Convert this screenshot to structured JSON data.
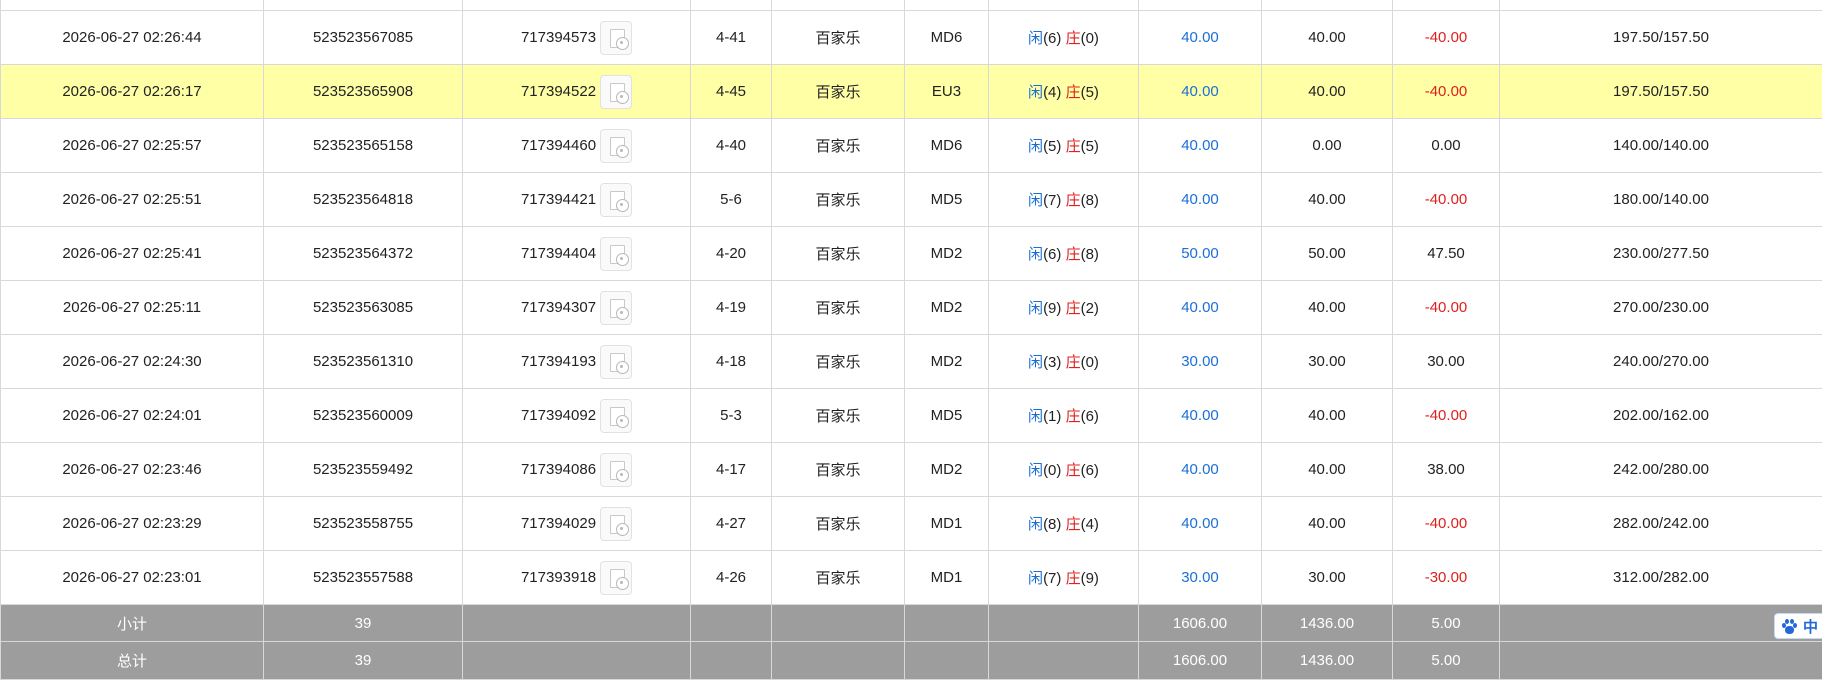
{
  "colors": {
    "blue": "#1a6fd6",
    "red": "#e0201f",
    "highlight": "#ffffa6",
    "summary_bg": "#9d9d9d"
  },
  "records": [
    {
      "time": "2026-06-27 02:26:44",
      "bet_id": "523523567085",
      "game_id": "717394573",
      "shoe": "4-41",
      "game_type": "百家乐",
      "table": "MD6",
      "player_label": "闲",
      "player_score": "(6)",
      "banker_label": "庄",
      "banker_score": "(0)",
      "bet_amount": "40.00",
      "valid_bet": "40.00",
      "win_loss": "-40.00",
      "balance": "197.50/157.50"
    },
    {
      "time": "2026-06-27 02:26:17",
      "bet_id": "523523565908",
      "game_id": "717394522",
      "shoe": "4-45",
      "game_type": "百家乐",
      "table": "EU3",
      "player_label": "闲",
      "player_score": "(4)",
      "banker_label": "庄",
      "banker_score": "(5)",
      "bet_amount": "40.00",
      "valid_bet": "40.00",
      "win_loss": "-40.00",
      "balance": "197.50/157.50"
    },
    {
      "time": "2026-06-27 02:25:57",
      "bet_id": "523523565158",
      "game_id": "717394460",
      "shoe": "4-40",
      "game_type": "百家乐",
      "table": "MD6",
      "player_label": "闲",
      "player_score": "(5)",
      "banker_label": "庄",
      "banker_score": "(5)",
      "bet_amount": "40.00",
      "valid_bet": "0.00",
      "win_loss": "0.00",
      "balance": "140.00/140.00"
    },
    {
      "time": "2026-06-27 02:25:51",
      "bet_id": "523523564818",
      "game_id": "717394421",
      "shoe": "5-6",
      "game_type": "百家乐",
      "table": "MD5",
      "player_label": "闲",
      "player_score": "(7)",
      "banker_label": "庄",
      "banker_score": "(8)",
      "bet_amount": "40.00",
      "valid_bet": "40.00",
      "win_loss": "-40.00",
      "balance": "180.00/140.00"
    },
    {
      "time": "2026-06-27 02:25:41",
      "bet_id": "523523564372",
      "game_id": "717394404",
      "shoe": "4-20",
      "game_type": "百家乐",
      "table": "MD2",
      "player_label": "闲",
      "player_score": "(6)",
      "banker_label": "庄",
      "banker_score": "(8)",
      "bet_amount": "50.00",
      "valid_bet": "50.00",
      "win_loss": "47.50",
      "balance": "230.00/277.50"
    },
    {
      "time": "2026-06-27 02:25:11",
      "bet_id": "523523563085",
      "game_id": "717394307",
      "shoe": "4-19",
      "game_type": "百家乐",
      "table": "MD2",
      "player_label": "闲",
      "player_score": "(9)",
      "banker_label": "庄",
      "banker_score": "(2)",
      "bet_amount": "40.00",
      "valid_bet": "40.00",
      "win_loss": "-40.00",
      "balance": "270.00/230.00"
    },
    {
      "time": "2026-06-27 02:24:30",
      "bet_id": "523523561310",
      "game_id": "717394193",
      "shoe": "4-18",
      "game_type": "百家乐",
      "table": "MD2",
      "player_label": "闲",
      "player_score": "(3)",
      "banker_label": "庄",
      "banker_score": "(0)",
      "bet_amount": "30.00",
      "valid_bet": "30.00",
      "win_loss": "30.00",
      "balance": "240.00/270.00"
    },
    {
      "time": "2026-06-27 02:24:01",
      "bet_id": "523523560009",
      "game_id": "717394092",
      "shoe": "5-3",
      "game_type": "百家乐",
      "table": "MD5",
      "player_label": "闲",
      "player_score": "(1)",
      "banker_label": "庄",
      "banker_score": "(6)",
      "bet_amount": "40.00",
      "valid_bet": "40.00",
      "win_loss": "-40.00",
      "balance": "202.00/162.00"
    },
    {
      "time": "2026-06-27 02:23:46",
      "bet_id": "523523559492",
      "game_id": "717394086",
      "shoe": "4-17",
      "game_type": "百家乐",
      "table": "MD2",
      "player_label": "闲",
      "player_score": "(0)",
      "banker_label": "庄",
      "banker_score": "(6)",
      "bet_amount": "40.00",
      "valid_bet": "40.00",
      "win_loss": "38.00",
      "balance": "242.00/280.00"
    },
    {
      "time": "2026-06-27 02:23:29",
      "bet_id": "523523558755",
      "game_id": "717394029",
      "shoe": "4-27",
      "game_type": "百家乐",
      "table": "MD1",
      "player_label": "闲",
      "player_score": "(8)",
      "banker_label": "庄",
      "banker_score": "(4)",
      "bet_amount": "40.00",
      "valid_bet": "40.00",
      "win_loss": "-40.00",
      "balance": "282.00/242.00"
    },
    {
      "time": "2026-06-27 02:23:01",
      "bet_id": "523523557588",
      "game_id": "717393918",
      "shoe": "4-26",
      "game_type": "百家乐",
      "table": "MD1",
      "player_label": "闲",
      "player_score": "(7)",
      "banker_label": "庄",
      "banker_score": "(9)",
      "bet_amount": "30.00",
      "valid_bet": "30.00",
      "win_loss": "-30.00",
      "balance": "312.00/282.00"
    }
  ],
  "highlight_index": 1,
  "summary": {
    "subtotal": {
      "label": "小计",
      "count": "39",
      "bet_amount": "1606.00",
      "valid_bet": "1436.00",
      "win_loss": "5.00"
    },
    "total": {
      "label": "总计",
      "count": "39",
      "bet_amount": "1606.00",
      "valid_bet": "1436.00",
      "win_loss": "5.00"
    }
  },
  "ime_badge": {
    "icon": "paw-icon",
    "label": "中"
  }
}
